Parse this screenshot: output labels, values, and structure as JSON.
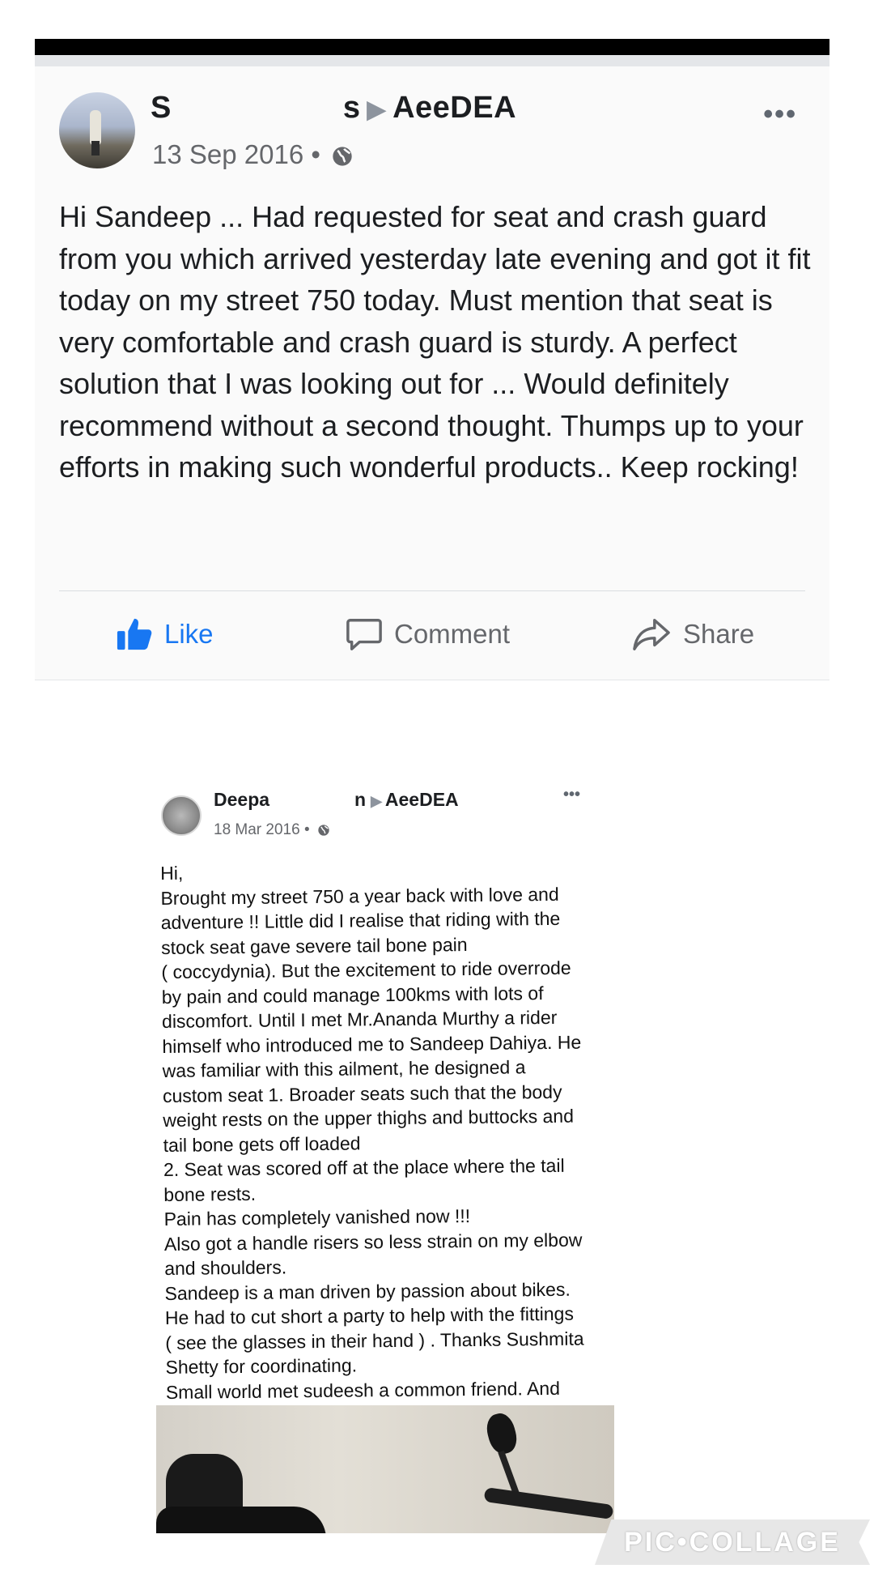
{
  "post1": {
    "author_prefix": "S",
    "author_suffix": "s",
    "page_name": "AeeDEA",
    "more": "•••",
    "date": "13 Sep 2016 •",
    "body": "Hi Sandeep ... Had requested for seat and crash guard from you which arrived yesterday late evening and got it fit today on my street 750 today. Must mention that seat is very comfortable and crash guard is sturdy. A perfect solution that I was looking out for ... Would definitely recommend without a second thought. Thumps up to your efforts in making such wonderful products.. Keep rocking!",
    "actions": {
      "like": "Like",
      "comment": "Comment",
      "share": "Share"
    },
    "colors": {
      "like": "#1877f2",
      "muted": "#65676b"
    }
  },
  "post2": {
    "author_prefix": "Deepa",
    "author_suffix": "n",
    "page_name": "AeeDEA",
    "more": "•••",
    "date": "18 Mar 2016 •",
    "body_lines": [
      "Hi,",
      "Brought my street 750 a year back with  love and",
      "adventure !! Little did I realise that riding with the",
      "stock seat gave severe  tail bone pain",
      "( coccydynia). But the excitement to ride overrode",
      "by pain and could manage 100kms with  lots of",
      "discomfort. Until I met Mr.Ananda Murthy a rider",
      "himself who introduced me to Sandeep Dahiya. He",
      "was familiar with this ailment, he designed a",
      "custom seat 1. Broader seats such that the body",
      "weight rests on the upper thighs and buttocks and",
      "tail bone gets off loaded",
      "2. Seat was scored off at the place where the tail",
      "bone rests.",
      "Pain has completely vanished now !!!",
      "Also got a handle risers so less strain on my elbow",
      "and shoulders.",
      "Sandeep is a man driven by passion about bikes.",
      "He had to cut short a party to help with the fittings",
      "( see the glasses in their hand ) . Thanks Sushmita",
      "Shetty for coordinating.",
      "Small world met   sudeesh a common friend. And"
    ]
  },
  "watermark": "PIC•COLLAGE"
}
